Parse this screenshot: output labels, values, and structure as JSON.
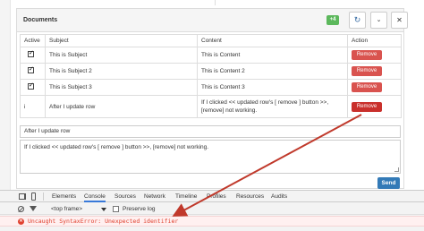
{
  "panel": {
    "title": "Documents",
    "add_label": "+4",
    "refresh_icon": "↻",
    "collapse_icon": "⌄",
    "close_icon": "✕"
  },
  "table": {
    "headers": [
      "Active",
      "Subject",
      "Content",
      "Action"
    ],
    "rows": [
      {
        "active": "checked",
        "subject": "This is Subject",
        "content": "This is Content",
        "action": "Remove"
      },
      {
        "active": "checked",
        "subject": "This is Subject 2",
        "content": "This is Content 2",
        "action": "Remove"
      },
      {
        "active": "checked",
        "subject": "This is Subject 3",
        "content": "This is Content 3",
        "action": "Remove"
      },
      {
        "active": "i",
        "subject": "After I update row",
        "content": "If I clicked << updated row's [ remove ] button >>, [remove] not working.",
        "action": "Remove"
      }
    ]
  },
  "form": {
    "subject_value": "After I update row",
    "content_value": "If I clicked  << updated row's [ remove ] button >>,  [remove] not working.",
    "send_label": "Send"
  },
  "devtools": {
    "tabs": [
      "Elements",
      "Console",
      "Sources",
      "Network",
      "Timeline",
      "Profiles",
      "Resources",
      "Audits"
    ],
    "active_tab": "Console",
    "frame_select": "<top frame>",
    "preserve_log_label": "Preserve log",
    "error_message": "Uncaught SyntaxError: Unexpected identifier"
  },
  "colors": {
    "remove_button": "#d9534f",
    "add_button": "#5cb85c",
    "send_button": "#337ab7",
    "error_text": "#e0412f",
    "annotation_arrow": "#c0392b"
  }
}
